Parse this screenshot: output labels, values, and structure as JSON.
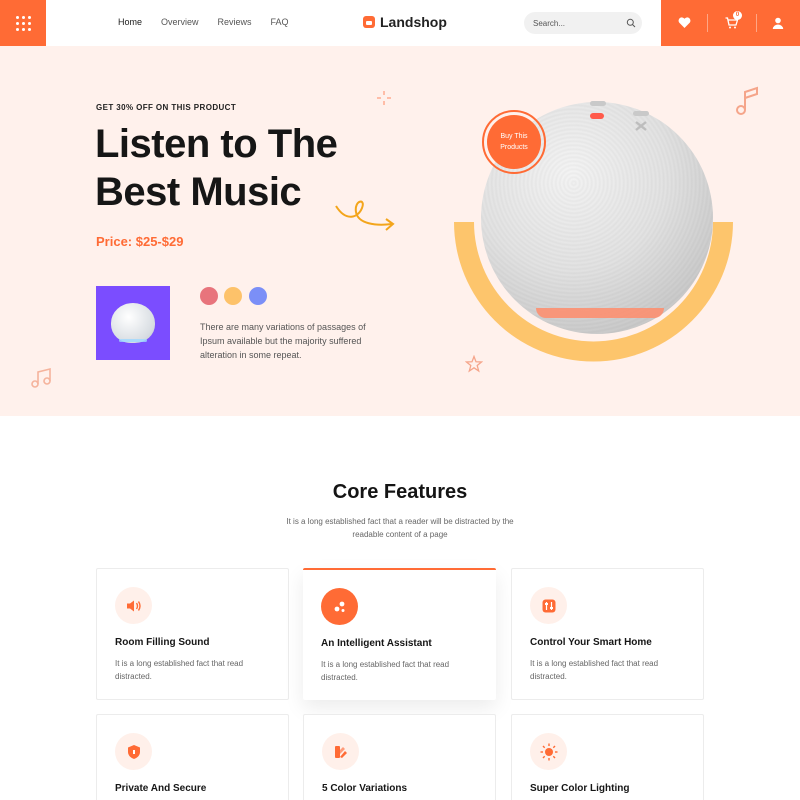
{
  "header": {
    "nav": [
      "Home",
      "Overview",
      "Reviews",
      "FAQ"
    ],
    "brand": "Landshop",
    "search_placeholder": "Search...",
    "cart_count": "0",
    "accent": "#ff6b35"
  },
  "hero": {
    "eyebrow": "GET 30% OFF ON THIS PRODUCT",
    "title": "Listen to The Best Music",
    "price": "Price: $25-$29",
    "description": "There are many variations of passages of Ipsum available but the majority suffered alteration in some repeat.",
    "badge": "Buy This Products",
    "swatches": [
      "#e8747c",
      "#fdc26a",
      "#7b8ff7"
    ],
    "thumbnail_bg": "#7b4dff"
  },
  "features": {
    "title": "Core Features",
    "subtitle": "It is a long established fact that a reader will be distracted by the readable content of a page",
    "items": [
      {
        "title": "Room Filling Sound",
        "text": "It is a long established fact that read distracted.",
        "icon": "speaker-icon"
      },
      {
        "title": "An Intelligent Assistant",
        "text": "It is a long established fact that read distracted.",
        "icon": "assistant-icon"
      },
      {
        "title": "Control Your Smart Home",
        "text": "It is a long established fact that read distracted.",
        "icon": "sliders-icon"
      },
      {
        "title": "Private And Secure",
        "text": "",
        "icon": "shield-icon"
      },
      {
        "title": "5 Color Variations",
        "text": "",
        "icon": "palette-icon"
      },
      {
        "title": "Super Color Lighting",
        "text": "",
        "icon": "sun-icon"
      }
    ]
  }
}
